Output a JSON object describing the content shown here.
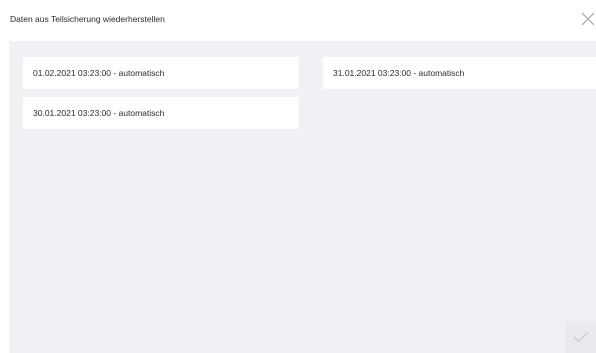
{
  "dialog": {
    "title": "Daten aus Teilsicherung wiederherstellen",
    "close_icon": "close-icon",
    "confirm_icon": "checkmark-icon"
  },
  "backups": [
    {
      "label": "01.02.2021 03:23:00 - automatisch"
    },
    {
      "label": "31.01.2021 03:23:00 - automatisch"
    },
    {
      "label": "30.01.2021 03:23:00 - automatisch"
    }
  ],
  "colors": {
    "content_background": "#f1f1f5",
    "item_background": "#ffffff",
    "text": "#2a2a2a",
    "icon": "#9a9a9a",
    "confirm_icon": "#c4c4c8"
  }
}
